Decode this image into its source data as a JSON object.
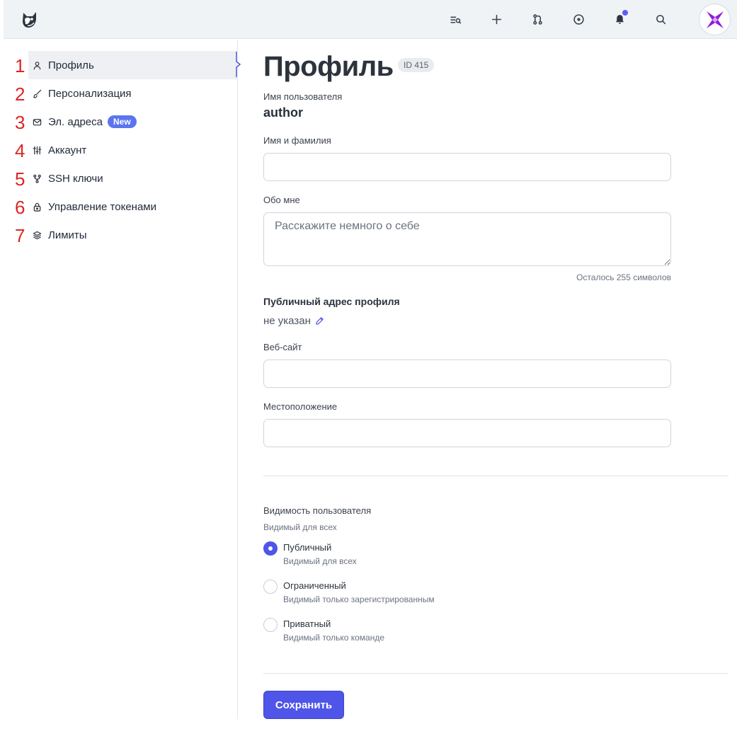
{
  "topbar": {
    "logo_icon": "fox-logo-icon",
    "icons": [
      "search-list-icon",
      "plus-icon",
      "pull-request-icon",
      "issue-circle-icon",
      "bell-icon",
      "search-icon"
    ],
    "notification_dot_color": "#5b5ef4",
    "avatar_icon": "purple-star-avatar-icon"
  },
  "sidebar": {
    "items": [
      {
        "num": "1",
        "label": "Профиль",
        "icon": "user-icon",
        "active": true
      },
      {
        "num": "2",
        "label": "Персонализация",
        "icon": "brush-icon"
      },
      {
        "num": "3",
        "label": "Эл. адреса",
        "icon": "mail-icon",
        "badge": "New"
      },
      {
        "num": "4",
        "label": "Аккаунт",
        "icon": "sliders-icon"
      },
      {
        "num": "5",
        "label": "SSH ключи",
        "icon": "fork-icon"
      },
      {
        "num": "6",
        "label": "Управление токенами",
        "icon": "lock-icon"
      },
      {
        "num": "7",
        "label": "Лимиты",
        "icon": "layers-icon"
      }
    ]
  },
  "main": {
    "title": "Профиль",
    "id_badge": "ID 415",
    "username_label": "Имя пользователя",
    "username": "author",
    "fullname_label": "Имя и фамилия",
    "fullname_value": "",
    "about_label": "Обо мне",
    "about_placeholder": "Расскажите немного о себе",
    "chars_left": "Осталось 255 символов",
    "public_address_label": "Публичный адрес профиля",
    "public_address_value": "не указан",
    "website_label": "Веб-сайт",
    "website_value": "",
    "location_label": "Местоположение",
    "location_value": "",
    "visibility_label": "Видимость пользователя",
    "visibility_current": "Видимый для всех",
    "visibility_options": [
      {
        "label": "Публичный",
        "desc": "Видимый для всех",
        "checked": true
      },
      {
        "label": "Ограниченный",
        "desc": "Видимый только зарегистрированным",
        "checked": false
      },
      {
        "label": "Приватный",
        "desc": "Видимый только команде",
        "checked": false
      }
    ],
    "save_label": "Сохранить"
  },
  "colors": {
    "accent": "#4f55e8",
    "badge_new": "#5b75f0",
    "annotation_numbers": "#dc2626"
  }
}
